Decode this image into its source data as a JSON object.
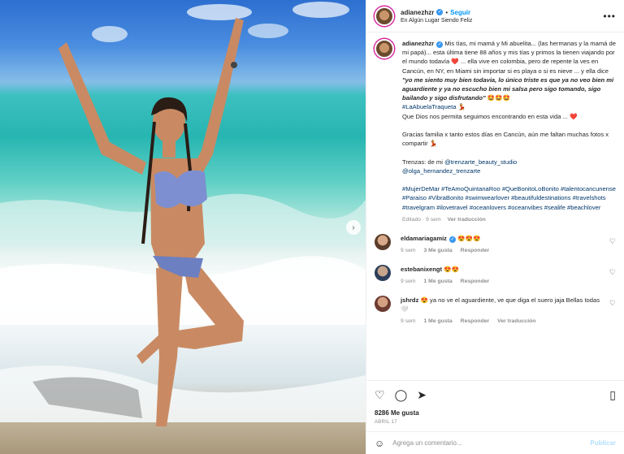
{
  "header": {
    "username": "adianezhzr",
    "follow": "Seguir",
    "location": "En Algún Lugar Siendo Feliz",
    "separator": "•",
    "more": "•••"
  },
  "caption": {
    "username": "adianezhzr",
    "text1": " Mis tías, mi mamá y Mi abuelita... (las hermanas y la mamá de mi papá)... esta última tiene 88 años y mis tías y primos la tienen viajando por el mundo todavía ❤️ ... ella vive en colombia, pero de repente la ves en Cancún, en NY, en Miami sin importar si es playa o si es nieve ... y ella dice ",
    "quote": "\"yo me siento muy bien todavia, lo único triste es que ya no veo bien mi aguardiente y ya no escucho bien mi salsa pero sigo tomando, sigo bailando y sigo disfrutando\"",
    "text2": " 🤩🤩🤩",
    "hashtag1": "#LaAbuelaTraqueta",
    "text3": " 💃",
    "line2": "Que Dios nos permita seguimos encontrando en esta vida ... ❤️",
    "line3": "Gracias familia x tanto estos días en Cancún, aún me faltan muchas fotos x compartir 💃",
    "trenzas_label": "Trenzas: de mi ",
    "trenzas_link1": "@trenzarte_beauty_studio",
    "trenzas_link2": "@olga_hernandez_trenzarte",
    "hashtags": "#MujerDeMar #TeAmoQuintanaRoo #QueBonitoLoBonito #talentocancunense #Paraiso #VibraBonito #swimwearlover #beautifuldestinations #travelshots #travelgram #ilovetravel #oceanlovers #oceanvibes #sealife #beachlover",
    "edited": "Editado · 9 sem",
    "see_translation": "Ver traducción"
  },
  "comments": [
    {
      "username": "eldamariagamiz",
      "text": " 😍😍😍",
      "time": "9 sem",
      "likes": "3 Me gusta",
      "reply": "Responder",
      "translate": ""
    },
    {
      "username": "estebanixengt",
      "text": " 😍😍",
      "time": "9 sem",
      "likes": "1 Me gusta",
      "reply": "Responder",
      "translate": ""
    },
    {
      "username": "jshrdz",
      "text": " 😍 ya no ve el aguardiente, ve que diga el suero jaja Bellas todas 🤍",
      "time": "9 sem",
      "likes": "1 Me gusta",
      "reply": "Responder",
      "translate": "Ver traducción"
    }
  ],
  "likes_count": "8286 Me gusta",
  "post_date": "ABRIL 17",
  "add_comment": {
    "placeholder": "Agrega un comentario...",
    "post": "Publicar"
  },
  "icons": {
    "heart": "♡",
    "comment": "◯",
    "share": "➤",
    "save": "▯",
    "emoji": "☺",
    "next": "›",
    "verified": "✓"
  },
  "colors": {
    "accent": "#0095f6",
    "link": "#00376b",
    "muted": "#8e8e8e"
  }
}
